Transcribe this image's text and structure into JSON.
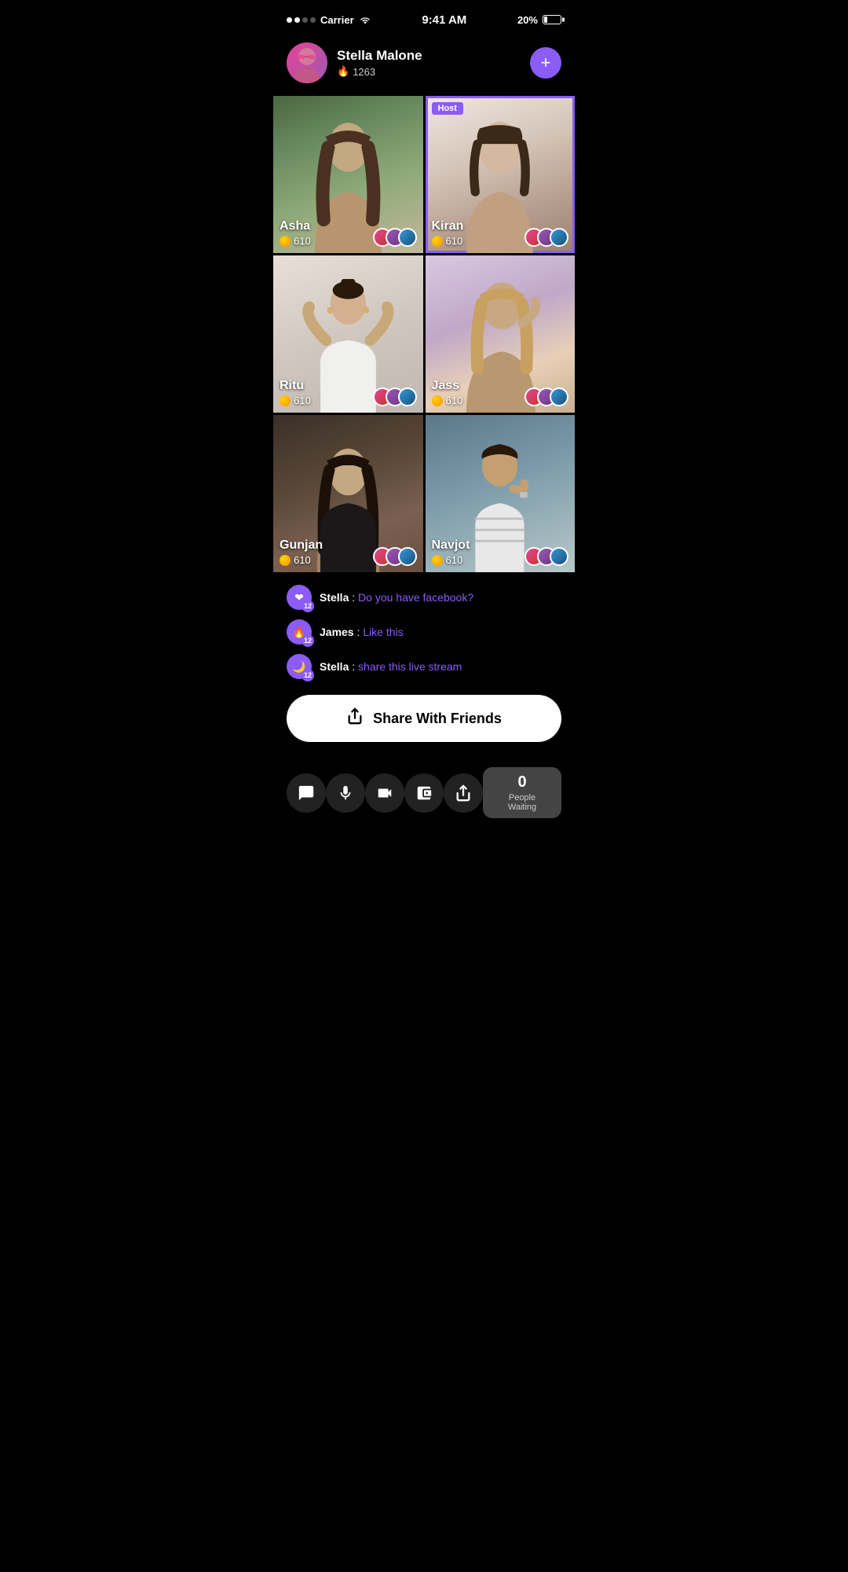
{
  "statusBar": {
    "carrier": "Carrier",
    "time": "9:41 AM",
    "battery": "20%"
  },
  "profile": {
    "name": "Stella Malone",
    "score": "1263",
    "addButtonLabel": "+"
  },
  "grid": {
    "cells": [
      {
        "id": "asha",
        "name": "Asha",
        "coins": "610",
        "isHost": false,
        "bgClass": "bg-asha"
      },
      {
        "id": "kiran",
        "name": "Kiran",
        "coins": "610",
        "isHost": true,
        "hostLabel": "Host",
        "bgClass": "bg-kiran"
      },
      {
        "id": "ritu",
        "name": "Ritu",
        "coins": "610",
        "isHost": false,
        "bgClass": "bg-ritu"
      },
      {
        "id": "jass",
        "name": "Jass",
        "coins": "610",
        "isHost": false,
        "bgClass": "bg-jass"
      },
      {
        "id": "gunjan",
        "name": "Gunjan",
        "coins": "610",
        "isHost": false,
        "bgClass": "bg-gunjan"
      },
      {
        "id": "navjot",
        "name": "Navjot",
        "coins": "610",
        "isHost": false,
        "bgClass": "bg-navjot"
      }
    ]
  },
  "chat": {
    "messages": [
      {
        "id": "msg1",
        "icon": "❤",
        "badge": "12",
        "username": "Stella",
        "separator": " : ",
        "text": "Do you have facebook?"
      },
      {
        "id": "msg2",
        "icon": "🔥",
        "badge": "12",
        "username": "James",
        "separator": " : ",
        "text": "Like this"
      },
      {
        "id": "msg3",
        "icon": "🌙",
        "badge": "12",
        "username": "Stella",
        "separator": " : ",
        "text": "share this live stream"
      }
    ]
  },
  "shareButton": {
    "label": "Share With Friends"
  },
  "bottomBar": {
    "icons": [
      "chat",
      "mic",
      "video",
      "wallet",
      "share"
    ],
    "peopleWaiting": {
      "count": "0",
      "label": "People Waiting"
    }
  }
}
